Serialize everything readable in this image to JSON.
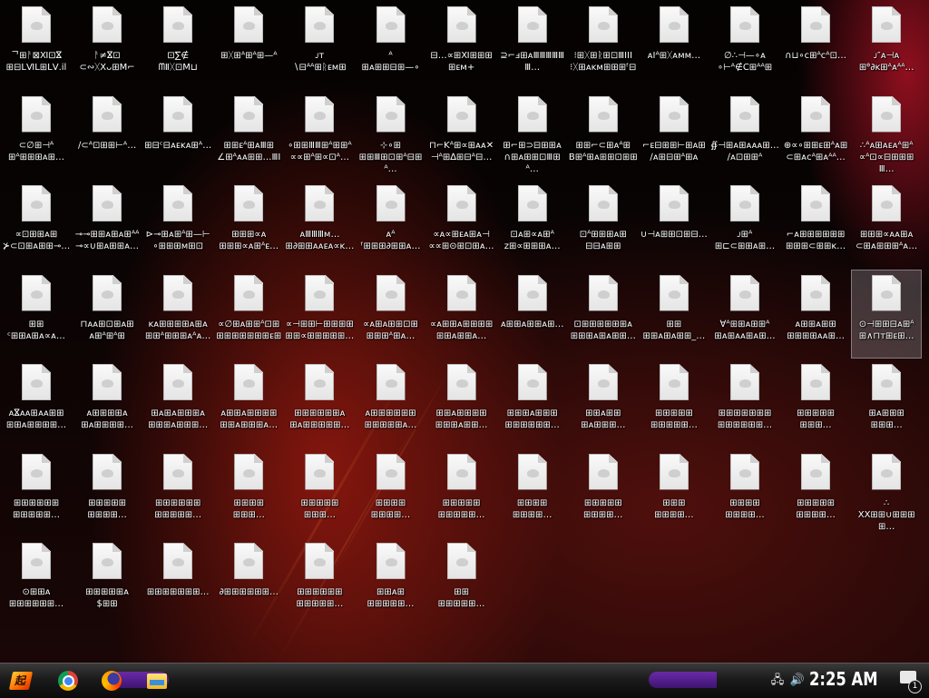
{
  "desktop": {
    "selected_index": 51,
    "icons": [
      {
        "label": "ᄀ⊞ᚨ⊠Ⅺ⊡ⴵ\n⊞⊟ⅬⅥⅬ⊞ⅬⅤ.ⅰⅼ"
      },
      {
        "label": "ᚨ≠ⴵ⊡\n⊂∾ᚷXᴗ⊞Ⅿ⌐"
      },
      {
        "label": "⊡∑∉\nᗰⅡᚷ⊡Ⅿ⊔"
      },
      {
        "label": "⊞ᚷ⊞ᴬ⊞ᴬ⊞—ᴬ"
      },
      {
        "label": "ᴊᴛ\n∖⊟ᴬᴬ⊞ᚱᴇᴍ⊞"
      },
      {
        "label": "ᴬ\n⊞ᴀ⊞⊞⊟⊞—∘"
      },
      {
        "label": "⊟…∝⊞Ⅺ⊞⊞⊞⊞ᴇᴍ+"
      },
      {
        "label": "⊇⌐ⅎ⊞ᴀⅢⅢⅢⅢⅢⅢ…"
      },
      {
        "label": "⁝⊞ᚷ⊞ᚱ⊞⊡ⅢⅠⅠⅠ\n⁝ᚷ⊞ᴀᴋᴍ⊞⊞⊞ᶠ⊟"
      },
      {
        "label": "ᴀⅠᴬ⊞ᚷᴀᴍᴍ…"
      },
      {
        "label": "∅∴⊣—∘ᴀ\n∘⊢ᴬ∉Ⅽ⊞ᴬᴬ⊞"
      },
      {
        "label": "∩⊔∘ᴄ⊞ᴬᴄᴬ⊡…"
      },
      {
        "label": "ᴊ″ᴀ⊣ᴀ\n⊞ᶿ∂ᴋ⊞ᴬᴀᴬᴬ…"
      },
      {
        "label": "⊂∅⊞⊣ᴬ\n⊞ᴬ⊞⊞⊞ᴀ⊞…"
      },
      {
        "label": "∕⊂ᴬ⊡⊞⊞⊢ᴬ…"
      },
      {
        "label": "⊞⊟ᶜ⊟ᴀᴇᴋᴀ⊞ᴬ…"
      },
      {
        "label": "⊞⊞ᴇᴬ⊞ᴀⅢ⊞\n∠⊞ᴬᴀᴀ⊞⊞…ⅢⅠ"
      },
      {
        "label": "∘⊞⊞ⅢⅢ⊞ᴬ⊞⊞ᴬ\n∝∝⊞ᴬ⊞∝⊡ᴬ…"
      },
      {
        "label": "⊹∘⊞\n⊞⊞Ⅲ⊞⊡⊞ᴬ⊟⊞ᴬ…"
      },
      {
        "label": "⊓⌐Kᴬ⊞∝⊞ᴀᴀ✕\n⊣ᴬ⊞∆⊞⊟ᴬ⊟…"
      },
      {
        "label": "⊞⌐⊞⊃⊟⊞⊞ᴀ\n∩⊞ᴀ⊞⊞⊡Ⅲ⊞ᴬ…"
      },
      {
        "label": "⊞⊞⌐⊂⊞ᴀᴬ⊞\nB⊞ᴬ⊞ᴀ⊞⊞⊡⊞⊞"
      },
      {
        "label": "⌐ᴇ⊟⊞⊞⊢⊞ᴀ⊞\n∕ᴀ⊞⊟⊞ᴬ⊞ᴀ"
      },
      {
        "label": "∯⊣⊞ᴀ⊞ᴀᴀᴀ⊞…\n∕ᴀ⊡⊞⊞ᴬ"
      },
      {
        "label": "⊕∝∘⊞⊞ᴇ⊞ᴬᴀ⊞\n⊂⊞ᴀᴄᴬ⊞ᴀᴬᴬ…"
      },
      {
        "label": "∴ᴬᴀ⊞ᴀᴇᴀᴬ⊞ᴬ\n∝ᴬ⊡∝⊟⊞⊞⊞Ⅲ…"
      },
      {
        "label": "∝⊡⊞⊞ᴀ⊞\n⊁⊂⊡⊞ᴀ⊞⊞⊸…"
      },
      {
        "label": "⊸⊸⊞⊞ᴀ⊞ᴀ⊞ᴬᴬ\n⊸∝∪⊞ᴀ⊞⊞ᴀ…"
      },
      {
        "label": "⊳⊸⊞ᴀ⊞ᴬ⊞—⊢\n∘⊞⊞⊞ᴍ⊞⊡"
      },
      {
        "label": "⊞⊞⊞∝ᴀ\n⊞⊞⊞∝ᴀ⊞ᴬᴇ…"
      },
      {
        "label": "ᴀⅢⅢⅢᴍ…\n⊞∂⊞⊞ᴀᴀᴇᴀ∝ᴋ…"
      },
      {
        "label": "ᴀᴬ\nᶠ⊞⊞⊞∂⊞⊞ᴀ…"
      },
      {
        "label": "∝ᴀ∝⊞ᴇᴀ⊞ᴀ⊣\n∝∝⊞⊝⊞⊡⊞ᴀ…"
      },
      {
        "label": "⊡ᴀ⊞∝ᴀ⊞ᴬ\nᴢ⊞∝⊞⊞⊞ᴀ…"
      },
      {
        "label": "⊡ᴬ⊞⊞⊞ᴀ⊞\n⊟⊟ᴀ⊞⊞"
      },
      {
        "label": "∪⊣ᴀ⊞⊞⊡⊞⊟…"
      },
      {
        "label": "ᴊ⊞ᴬ\n⊞⊏⊂⊞⊞ᴀ⊞…"
      },
      {
        "label": "⌐ᴀ⊞⊞⊞⊞⊞⊞\n⊞⊞⊞⊂⊞⊞ᴋ…"
      },
      {
        "label": "⊞⊞⊞∝ᴀᴀ⊞ᴀ\n⊂⊞ᴀ⊞⊞⊞ᴬᴀ…"
      },
      {
        "label": "⊞⊞\nᶜ⊞⊞ᴀ⊞ᴀ∝ᴀ…"
      },
      {
        "label": "⊓ᴀᴀ⊞⊡⊞ᴀ⊞\nᴀ⊞ᴬ⊞ᴬ⊞"
      },
      {
        "label": "ᴋᴀ⊞⊞⊞⊞ᴀ⊞ᴀ\n⊞⊞ᴬ⊞⊞⊞ᴀᴬᴀ…"
      },
      {
        "label": "∝∅⊞ᴀ⊞⊞ᴬ⊡⊞\n⊞⊞⊞⊞⊞⊞⊞ᴇ⊞"
      },
      {
        "label": "∝⊣⊞⊞⊢⊞⊞⊞⊞\n⊞⊞∝⊞⊞⊞⊞⊞…"
      },
      {
        "label": "∝ᴀ⊞ᴀ⊞⊞⊡⊞\n⊞⊞⊞ᴬ⊞ᴀ…"
      },
      {
        "label": "∝ᴀ⊞⊞ᴀ⊞⊞⊞⊞\n⊞⊞ᴀ⊞⊞ᴀ…"
      },
      {
        "label": "ᴀ⊞⊞ᴀ⊞⊞ᴀ⊞…"
      },
      {
        "label": "⊡⊞⊞⊞⊞⊞⊞ᴀ\n⊞⊞⊞ᴀ⊞ᴀ⊞⊞…"
      },
      {
        "label": "⊞⊞\n⊞⊞ᴀ⊞ᴀ⊞⊞_…"
      },
      {
        "label": "∀ᴬ⊞⊞ᴀ⊞⊞ᴬ\n⊞ᴀ⊞ᴀᴀ⊞ᴀ⊞…"
      },
      {
        "label": "ᴀ⊞⊞ᴀ⊞⊞\n⊞⊞⊞⊞ᴀᴀ⊞…"
      },
      {
        "label": "⊙⊣⊞⊞⊟ᴀ⊞ᴬ\n⊞∧⊓ᴛ⊞ᴇ⊞…"
      },
      {
        "label": "ᴀⴵᴀᴀ⊞ᴀᴀ⊞⊞\n⊞⊞ᴀ⊞⊞⊞⊞…"
      },
      {
        "label": "ᴀ⊞⊞⊞⊞ᴀ\n⊞ᴀ⊞⊞⊞⊞…"
      },
      {
        "label": "⊞ᴀ⊞ᴀ⊞⊞⊞ᴀ\n⊞⊞⊞ᴀ⊞⊞⊞…"
      },
      {
        "label": "ᴀ⊞⊞ᴀ⊞⊞⊞⊞\n⊞⊞ᴀ⊞⊞⊞ᴀ…"
      },
      {
        "label": "⊞⊞⊞⊞⊞⊞ᴀ\n⊞ᴀ⊞⊞⊞⊞⊞…"
      },
      {
        "label": "ᴀ⊞⊞⊞⊞⊞⊞\n⊞⊞⊞⊞⊞ᴀ…"
      },
      {
        "label": "⊞⊞ᴀ⊞⊞⊞⊞\n⊞⊞⊞ᴀ⊞⊞…"
      },
      {
        "label": "⊞⊞⊞ᴀ⊞⊞⊞\n⊞⊞⊞⊞⊞⊞…"
      },
      {
        "label": "⊞⊞ᴀ⊞⊞\n⊞ᴀ⊞⊞⊞…"
      },
      {
        "label": "⊞⊞⊞⊞⊞\n⊞⊞⊞⊞⊞…"
      },
      {
        "label": "⊞⊞⊞⊞⊞⊞⊞\n⊞⊞⊞⊞⊞⊞…"
      },
      {
        "label": "⊞⊞⊞⊞⊞\n⊞⊞⊞…"
      },
      {
        "label": "⊞ᴀ⊞⊞⊞\n⊞⊞⊞…"
      },
      {
        "label": "⊞⊞⊞⊞⊞⊞\n⊞⊞⊞⊞⊞…"
      },
      {
        "label": "⊞⊞⊞⊞⊞\n⊞⊞⊞⊞…"
      },
      {
        "label": "⊞⊞⊞⊞⊞⊞\n⊞⊞⊞⊞⊞…"
      },
      {
        "label": "⊞⊞⊞⊞\n⊞⊞⊞…"
      },
      {
        "label": "⊞⊞⊞⊞⊞\n⊞⊞⊞…"
      },
      {
        "label": "⊞⊞⊞⊞\n⊞⊞⊞⊞…"
      },
      {
        "label": "⊞⊞⊞⊞⊞\n⊞⊞⊞⊞⊞…"
      },
      {
        "label": "⊞⊞⊞⊞\n⊞⊞⊞⊞…"
      },
      {
        "label": "⊞⊞⊞⊞⊞\n⊞⊞⊞⊞…"
      },
      {
        "label": "⊞⊞⊞\n⊞⊞⊞⊞…"
      },
      {
        "label": "⊞⊞⊞⊞\n⊞⊞⊞⊞…"
      },
      {
        "label": "⊞⊞⊞⊞⊞\n⊞⊞⊞⊞…"
      },
      {
        "label": "∴\nXX⊞⊞∪⊞⊞⊞⊞…"
      },
      {
        "label": "⊙⊞⊞ᴀ\n⊞⊞⊞⊞⊞⊞…"
      },
      {
        "label": "⊞⊞⊞⊞⊞ᴀ\n$⊞⊞"
      },
      {
        "label": "⊞⊞⊞⊞⊞⊞⊞…"
      },
      {
        "label": "∂⊞⊞⊞⊞⊞⊞…"
      },
      {
        "label": "⊞⊞⊞⊞⊞⊞\n⊞⊞⊞⊞⊞…"
      },
      {
        "label": "⊞⊞ᴀ⊞\n⊞⊞⊞⊞⊞…"
      },
      {
        "label": "⊞⊞\n⊞⊞⊞⊞⊞…"
      }
    ]
  },
  "taskbar": {
    "start_label": "起",
    "apps": [
      {
        "name": "chrome"
      },
      {
        "name": "firefox"
      },
      {
        "name": "file-explorer"
      }
    ],
    "tray": {
      "network_icon": "network-icon",
      "volume_icon": "volume-icon",
      "clock": "2:25 AM",
      "notification_count": "1"
    }
  },
  "colors": {
    "taskbar_accent": "#5a22a0",
    "label_text": "#ffffff"
  }
}
